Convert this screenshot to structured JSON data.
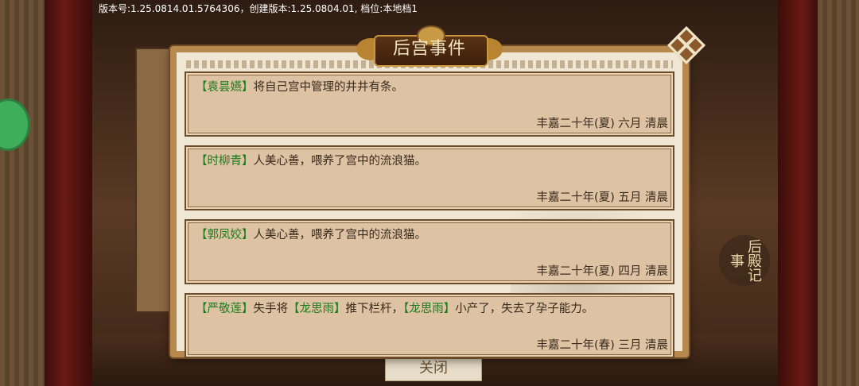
{
  "version_info": "版本号:1.25.0814.01.5764306，创建版本:1.25.0804.01, 档位:本地档1",
  "dialog": {
    "title": "后宫事件",
    "close_icon": "close-x-icon"
  },
  "events": [
    {
      "segments": [
        {
          "text": "【袁昙嬿】",
          "type": "name"
        },
        {
          "text": "将自己宫中管理的井井有条。",
          "type": "text"
        }
      ],
      "date": "丰嘉二十年(夏) 六月 清晨"
    },
    {
      "segments": [
        {
          "text": "【时柳青】",
          "type": "name"
        },
        {
          "text": "人美心善，喂养了宫中的流浪猫。",
          "type": "text"
        }
      ],
      "date": "丰嘉二十年(夏) 五月 清晨"
    },
    {
      "segments": [
        {
          "text": "【郭凤姣】",
          "type": "name"
        },
        {
          "text": "人美心善，喂养了宫中的流浪猫。",
          "type": "text"
        }
      ],
      "date": "丰嘉二十年(夏) 四月 清晨"
    },
    {
      "segments": [
        {
          "text": "【严敬莲】",
          "type": "name"
        },
        {
          "text": "失手将",
          "type": "text"
        },
        {
          "text": "【龙思雨】",
          "type": "name"
        },
        {
          "text": "推下栏杆，",
          "type": "text"
        },
        {
          "text": "【龙思雨】",
          "type": "name"
        },
        {
          "text": "小产了，失去了孕子能力。",
          "type": "text"
        }
      ],
      "date": "丰嘉二十年(春) 三月 清晨"
    }
  ],
  "side_emblem": "后殿记事",
  "bottom_button": "关闭",
  "colors": {
    "name_green": "#1f7a1f",
    "card_bg": "#ddc3a3",
    "dialog_frame": "#b8894f"
  }
}
